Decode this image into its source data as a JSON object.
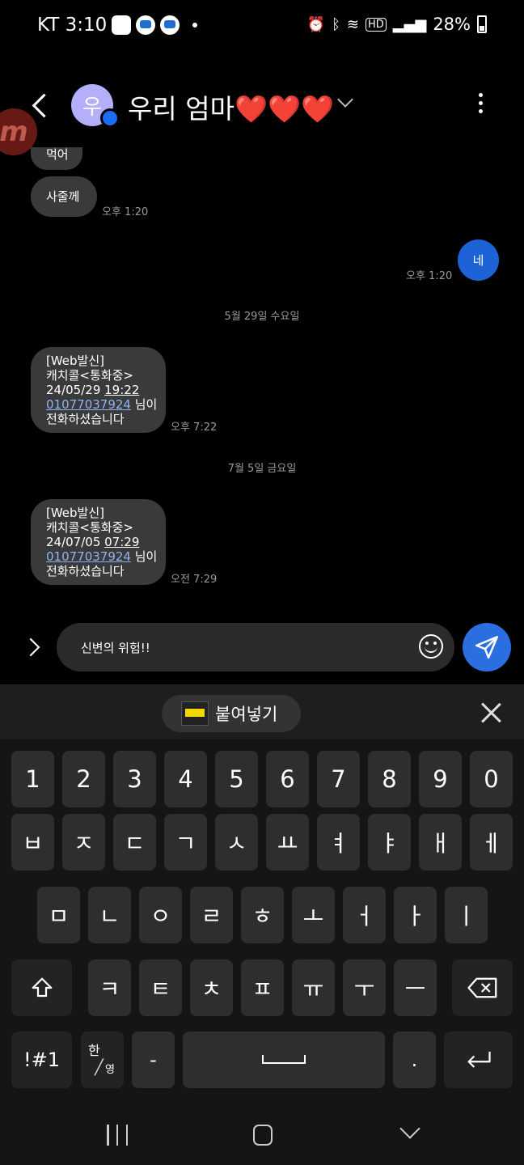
{
  "status_bar": {
    "carrier_time": "KT 3:10",
    "hd_label": "HD",
    "battery": "28%"
  },
  "header": {
    "avatar_initial": "우",
    "contact_name": "우리 엄마",
    "hearts": "❤️❤️❤️"
  },
  "floating_app_letter": "m",
  "messages": {
    "m1_text": "먹어",
    "m2_text": "사줄께",
    "m2_time": "오후 1:20",
    "m3_text": "네",
    "m3_time": "오후 1:20",
    "date1": "5월 29일 수요일",
    "m4": {
      "line1": "[Web발신]",
      "line2": "캐치콜<통화중>",
      "line3_date": "24/05/29 ",
      "line3_time": "19:22",
      "phone": "01077037924",
      "line4_suffix": " 님이",
      "line5": "전화하셨습니다",
      "time": "오후 7:22"
    },
    "date2": "7월 5일 금요일",
    "m5": {
      "line1": "[Web발신]",
      "line2": "캐치콜<통화중>",
      "line3_date": "24/07/05 ",
      "line3_time": "07:29",
      "phone": "01077037924",
      "line4_suffix": " 님이",
      "line5": "전화하셨습니다",
      "time": "오전 7:29"
    }
  },
  "composer": {
    "text": "신변의 위험!!"
  },
  "keyboard": {
    "paste_label": "붙여넣기",
    "row_numbers": [
      "1",
      "2",
      "3",
      "4",
      "5",
      "6",
      "7",
      "8",
      "9",
      "0"
    ],
    "row1": [
      "ㅂ",
      "ㅈ",
      "ㄷ",
      "ㄱ",
      "ㅅ",
      "ㅛ",
      "ㅕ",
      "ㅑ",
      "ㅐ",
      "ㅔ"
    ],
    "row2": [
      "ㅁ",
      "ㄴ",
      "ㅇ",
      "ㄹ",
      "ㅎ",
      "ㅗ",
      "ㅓ",
      "ㅏ",
      "ㅣ"
    ],
    "row3": [
      "ㅋ",
      "ㅌ",
      "ㅊ",
      "ㅍ",
      "ㅠ",
      "ㅜ",
      "ㅡ"
    ],
    "symbols_label": "!#1",
    "lang_top": "한",
    "lang_bottom": "영",
    "dash_label": "-",
    "period_label": "."
  }
}
